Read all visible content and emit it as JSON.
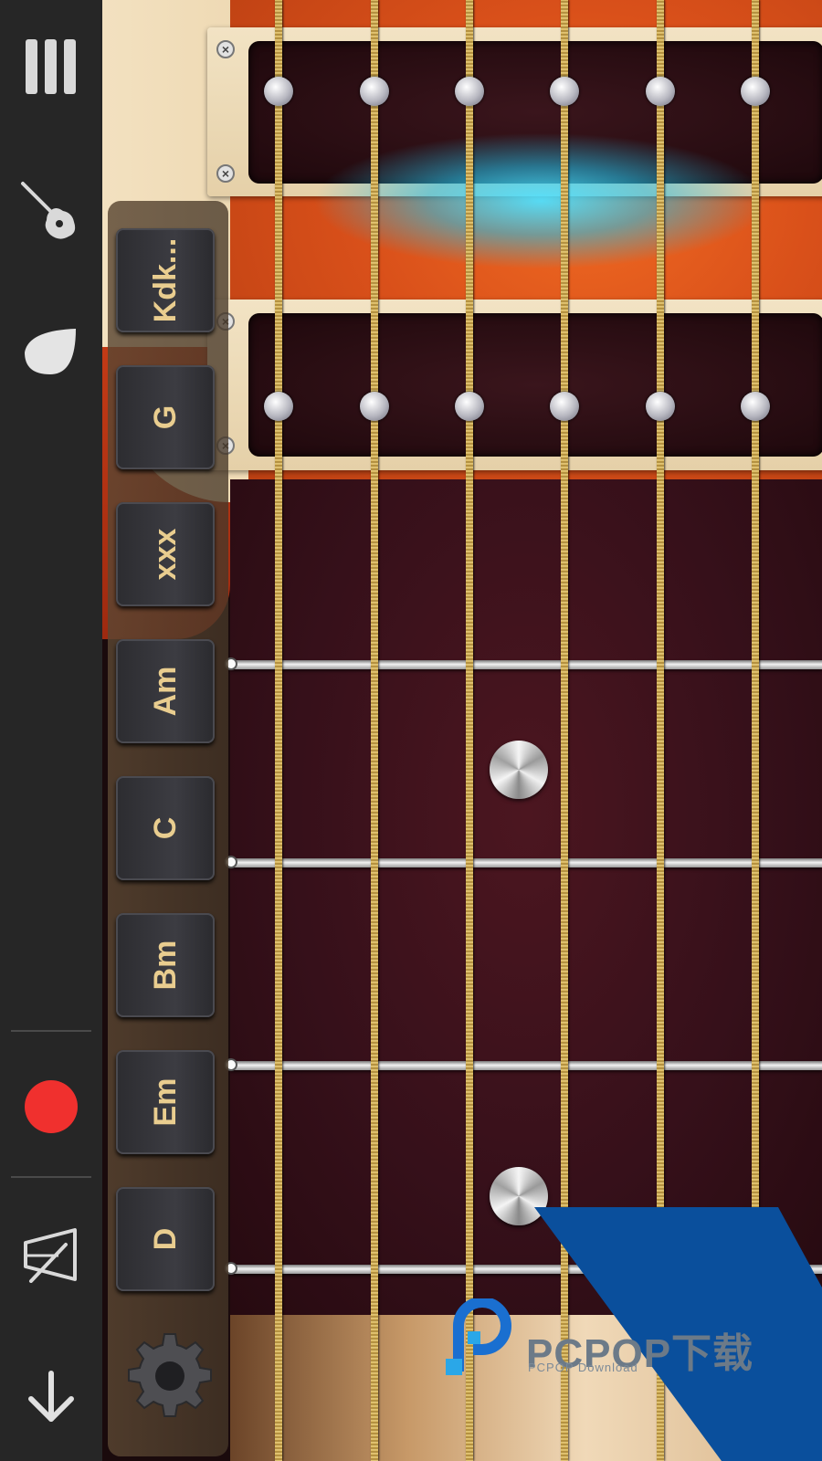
{
  "app": {
    "toolbar": {
      "menu_icon": "menu-bars-icon",
      "guitar_icon": "guitar-icon",
      "pick_icon": "guitar-pick-icon",
      "record_icon": "record-icon",
      "metronome_icon": "metronome-icon",
      "download_icon": "arrow-down-icon",
      "record_color": "#f0302e"
    },
    "chords": [
      {
        "label": "Kdk..."
      },
      {
        "label": "G"
      },
      {
        "label": "xxx"
      },
      {
        "label": "Am"
      },
      {
        "label": "C"
      },
      {
        "label": "Bm"
      },
      {
        "label": "Em"
      },
      {
        "label": "D"
      }
    ],
    "settings_icon": "gear-icon",
    "strings_count": 6
  },
  "watermark": {
    "title": "PCPOP下载",
    "subtitle": "PCPOP Download",
    "brand_color": "#0a4f9c"
  }
}
